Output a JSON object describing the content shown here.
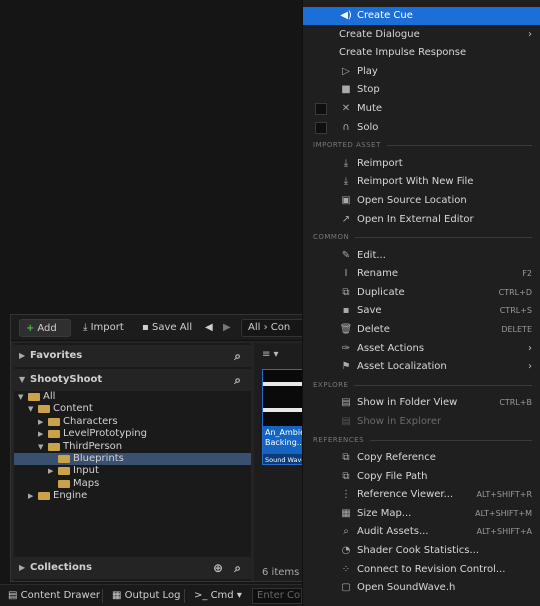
{
  "content_browser": {
    "toolbar": {
      "add_label": "Add",
      "import_label": "Import",
      "save_all_label": "Save All",
      "path_root": "All",
      "path_next": "Con"
    },
    "favorites_label": "Favorites",
    "project_label": "ShootyShoot",
    "collections_label": "Collections",
    "tree": [
      {
        "label": "All",
        "depth": 0,
        "expanded": true
      },
      {
        "label": "Content",
        "depth": 1,
        "expanded": true
      },
      {
        "label": "Characters",
        "depth": 2,
        "expanded": false
      },
      {
        "label": "LevelPrototyping",
        "depth": 2,
        "expanded": false
      },
      {
        "label": "ThirdPerson",
        "depth": 2,
        "expanded": true
      },
      {
        "label": "Blueprints",
        "depth": 3,
        "selected": true
      },
      {
        "label": "Input",
        "depth": 3,
        "expanded": false
      },
      {
        "label": "Maps",
        "depth": 3
      },
      {
        "label": "Engine",
        "depth": 1,
        "expanded": false
      }
    ],
    "asset": {
      "name_line1": "An_Ambie",
      "name_line2": "Backing...",
      "type": "Sound Wave"
    },
    "items_count": "6 items ("
  },
  "statusbar": {
    "content_drawer": "Content Drawer",
    "output_log": "Output Log",
    "cmd": "Cmd",
    "cmd_placeholder": "Enter Co"
  },
  "menu": {
    "sections": [
      {
        "type": "item",
        "label": "Create Cue",
        "icon": "speaker-icon",
        "glyph": "◀)",
        "highlight": true
      },
      {
        "type": "item",
        "label": "Create Dialogue",
        "submenu": true,
        "noicon": true
      },
      {
        "type": "item",
        "label": "Create Impulse Response",
        "noicon": true
      },
      {
        "type": "item",
        "label": "Play",
        "icon": "play-icon",
        "glyph": "▷"
      },
      {
        "type": "item",
        "label": "Stop",
        "icon": "stop-icon",
        "glyph": "■"
      },
      {
        "type": "item",
        "label": "Mute",
        "icon": "mute-icon",
        "glyph": "✕",
        "checkbox": true
      },
      {
        "type": "item",
        "label": "Solo",
        "icon": "headphones-icon",
        "glyph": "∩",
        "checkbox": true
      },
      {
        "type": "header",
        "label": "IMPORTED ASSET"
      },
      {
        "type": "item",
        "label": "Reimport",
        "icon": "reimport-icon",
        "glyph": "⤓"
      },
      {
        "type": "item",
        "label": "Reimport With New File",
        "icon": "reimport-file-icon",
        "glyph": "⤓"
      },
      {
        "type": "item",
        "label": "Open Source Location",
        "icon": "folder-open-icon",
        "glyph": "▣"
      },
      {
        "type": "item",
        "label": "Open In External Editor",
        "icon": "external-editor-icon",
        "glyph": "↗"
      },
      {
        "type": "header",
        "label": "COMMON"
      },
      {
        "type": "item",
        "label": "Edit...",
        "icon": "pencil-icon",
        "glyph": "✎"
      },
      {
        "type": "item",
        "label": "Rename",
        "icon": "rename-icon",
        "glyph": "I",
        "shortcut": "F2"
      },
      {
        "type": "item",
        "label": "Duplicate",
        "icon": "duplicate-icon",
        "glyph": "⧉",
        "shortcut": "CTRL+D"
      },
      {
        "type": "item",
        "label": "Save",
        "icon": "save-icon",
        "glyph": "▪",
        "shortcut": "CTRL+S"
      },
      {
        "type": "item",
        "label": "Delete",
        "icon": "trash-icon",
        "glyph": "🗑",
        "shortcut": "DELETE"
      },
      {
        "type": "item",
        "label": "Asset Actions",
        "icon": "wrench-icon",
        "glyph": "✑",
        "submenu": true
      },
      {
        "type": "item",
        "label": "Asset Localization",
        "icon": "flag-icon",
        "glyph": "⚑",
        "submenu": true
      },
      {
        "type": "header",
        "label": "EXPLORE"
      },
      {
        "type": "item",
        "label": "Show in Folder View",
        "icon": "folder-view-icon",
        "glyph": "▤",
        "shortcut": "CTRL+B"
      },
      {
        "type": "item",
        "label": "Show in Explorer",
        "icon": "explorer-icon",
        "glyph": "▤",
        "disabled": true
      },
      {
        "type": "header",
        "label": "REFERENCES"
      },
      {
        "type": "item",
        "label": "Copy Reference",
        "icon": "copy-reference-icon",
        "glyph": "⧉"
      },
      {
        "type": "item",
        "label": "Copy File Path",
        "icon": "copy-path-icon",
        "glyph": "⧉"
      },
      {
        "type": "item",
        "label": "Reference Viewer...",
        "icon": "reference-viewer-icon",
        "glyph": "⋮",
        "shortcut": "ALT+SHIFT+R"
      },
      {
        "type": "item",
        "label": "Size Map...",
        "icon": "size-map-icon",
        "glyph": "▦",
        "shortcut": "ALT+SHIFT+M"
      },
      {
        "type": "item",
        "label": "Audit Assets...",
        "icon": "audit-icon",
        "glyph": "⌕",
        "shortcut": "ALT+SHIFT+A"
      },
      {
        "type": "item",
        "label": "Shader Cook Statistics...",
        "icon": "shader-icon",
        "glyph": "◔"
      },
      {
        "type": "item",
        "label": "Connect to Revision Control...",
        "icon": "revision-control-icon",
        "glyph": "⁘"
      },
      {
        "type": "item",
        "label": "Open SoundWave.h",
        "icon": "code-file-icon",
        "glyph": "▢"
      }
    ]
  },
  "colors": {
    "highlight": "#1d6fd8",
    "selection": "#3a5070",
    "folder": "#c9a24a",
    "add_plus": "#3fbf3f"
  }
}
